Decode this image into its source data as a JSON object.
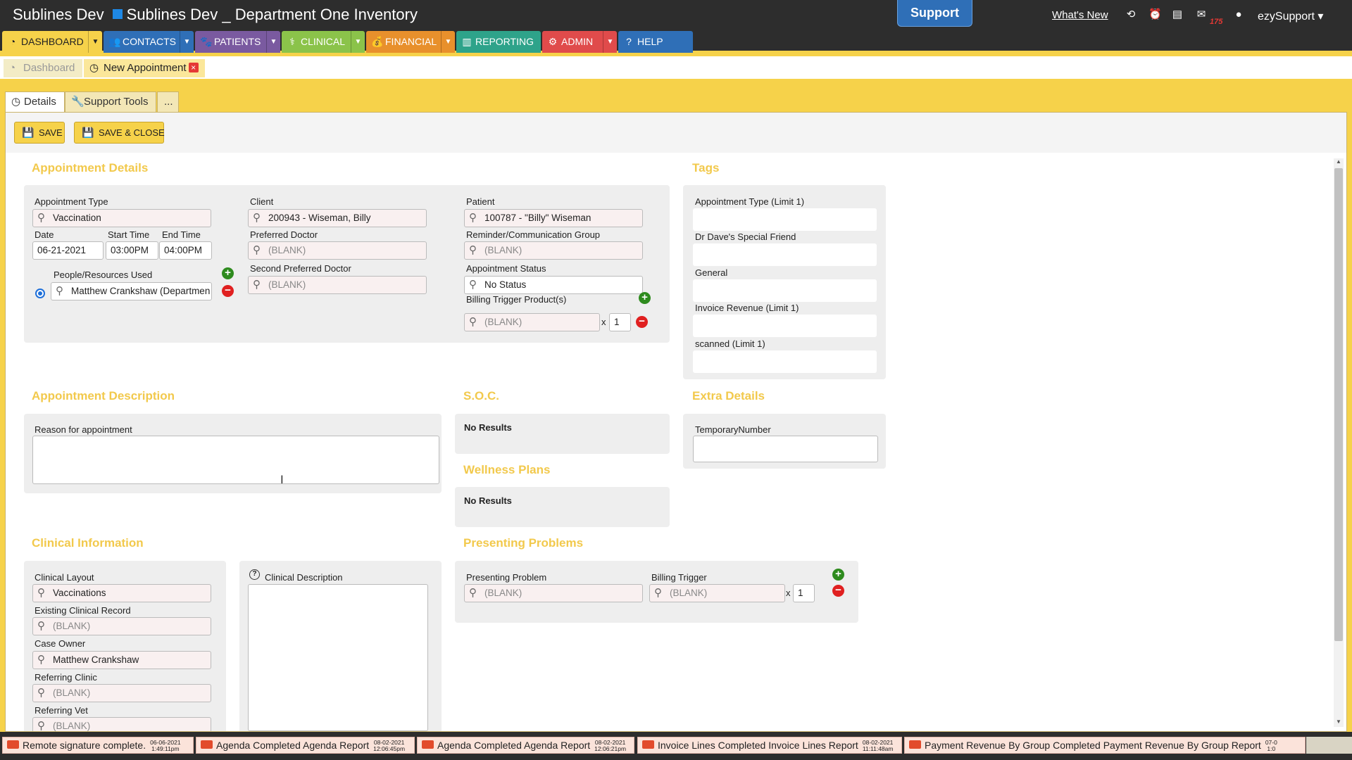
{
  "window": {
    "app_name": "Sublines Dev",
    "site_title": "Sublines Dev _ Department One Inventory"
  },
  "topbar": {
    "support_label": "Support",
    "whats_new_label": "What's New",
    "mail_count": "175",
    "user_label": "ezySupport ▾",
    "icons": [
      "history-icon",
      "alarm-icon",
      "printer-icon",
      "mail-icon",
      "user-icon"
    ]
  },
  "nav": [
    {
      "label": "DASHBOARD",
      "icon": "gauge-icon",
      "color": "#f6d24a"
    },
    {
      "label": "CONTACTS",
      "icon": "people-icon",
      "color": "#2f6fb7"
    },
    {
      "label": "PATIENTS",
      "icon": "paw-icon",
      "color": "#7a5aa0"
    },
    {
      "label": "CLINICAL",
      "icon": "stethoscope-icon",
      "color": "#8bc34a"
    },
    {
      "label": "FINANCIAL",
      "icon": "money-bag-icon",
      "color": "#e8902c"
    },
    {
      "label": "REPORTING",
      "icon": "chart-icon",
      "color": "#2ea38a"
    },
    {
      "label": "ADMIN",
      "icon": "gear-icon",
      "color": "#e04b4b"
    },
    {
      "label": "HELP",
      "icon": "question-icon",
      "color": "#2f6fb7"
    }
  ],
  "open_tabs": {
    "dashboard_label": "Dashboard",
    "current_label": "New Appointment"
  },
  "subtabs": {
    "details": "Details",
    "support_tools": "Support Tools",
    "more": "..."
  },
  "toolbar": {
    "save_label": "SAVE",
    "save_close_label": "SAVE & CLOSE"
  },
  "appointment_details": {
    "title": "Appointment Details",
    "type_label": "Appointment Type",
    "type_value": "Vaccination",
    "date_label": "Date",
    "date_value": "06-21-2021",
    "start_label": "Start Time",
    "start_value": "03:00PM",
    "end_label": "End Time",
    "end_value": "04:00PM",
    "people_label": "People/Resources Used",
    "people_value": "Matthew Crankshaw (Departmen",
    "client_label": "Client",
    "client_value": "200943 -  Wiseman, Billy",
    "pref_doctor_label": "Preferred Doctor",
    "pref_doctor_value": "(BLANK)",
    "second_doctor_label": "Second Preferred Doctor",
    "second_doctor_value": "(BLANK)",
    "patient_label": "Patient",
    "patient_value": "100787 - \"Billy\" Wiseman",
    "reminder_label": "Reminder/Communication Group",
    "reminder_value": "(BLANK)",
    "status_label": "Appointment Status",
    "status_value": "No Status",
    "billing_label": "Billing Trigger Product(s)",
    "billing_value": "(BLANK)",
    "billing_x": "x",
    "billing_qty": "1"
  },
  "tags": {
    "title": "Tags",
    "items": [
      "Appointment Type (Limit 1)",
      "Dr Dave's Special Friend",
      "General",
      "Invoice Revenue (Limit 1)",
      "scanned (Limit 1)"
    ]
  },
  "appointment_description": {
    "title": "Appointment Description",
    "reason_label": "Reason for appointment"
  },
  "soc": {
    "title": "S.O.C.",
    "result": "No Results"
  },
  "wellness": {
    "title": "Wellness Plans",
    "result": "No Results"
  },
  "extra_details": {
    "title": "Extra Details",
    "temp_label": "TemporaryNumber"
  },
  "clinical_info": {
    "title": "Clinical Information",
    "layout_label": "Clinical Layout",
    "layout_value": "Vaccinations",
    "existing_label": "Existing Clinical Record",
    "existing_value": "(BLANK)",
    "owner_label": "Case Owner",
    "owner_value": "Matthew Crankshaw",
    "ref_clinic_label": "Referring Clinic",
    "ref_clinic_value": "(BLANK)",
    "ref_vet_label": "Referring Vet",
    "ref_vet_value": "(BLANK)",
    "desc_label": "Clinical Description"
  },
  "presenting": {
    "title": "Presenting Problems",
    "problem_label": "Presenting Problem",
    "problem_value": "(BLANK)",
    "billing_label": "Billing Trigger",
    "billing_value": "(BLANK)",
    "x": "x",
    "qty": "1"
  },
  "notifications": [
    {
      "text": "Remote signature complete.",
      "date": "06-06-2021",
      "time": "1:49:11pm"
    },
    {
      "text": "Agenda Completed Agenda Report",
      "date": "08-02-2021",
      "time": "12:06:45pm"
    },
    {
      "text": "Agenda Completed Agenda Report",
      "date": "08-02-2021",
      "time": "12:06:21pm"
    },
    {
      "text": "Invoice Lines Completed Invoice Lines Report",
      "date": "08-02-2021",
      "time": "11:11:48am"
    },
    {
      "text": "Payment Revenue By Group Completed Payment Revenue By Group Report",
      "date": "07-0",
      "time": "1:0"
    }
  ]
}
